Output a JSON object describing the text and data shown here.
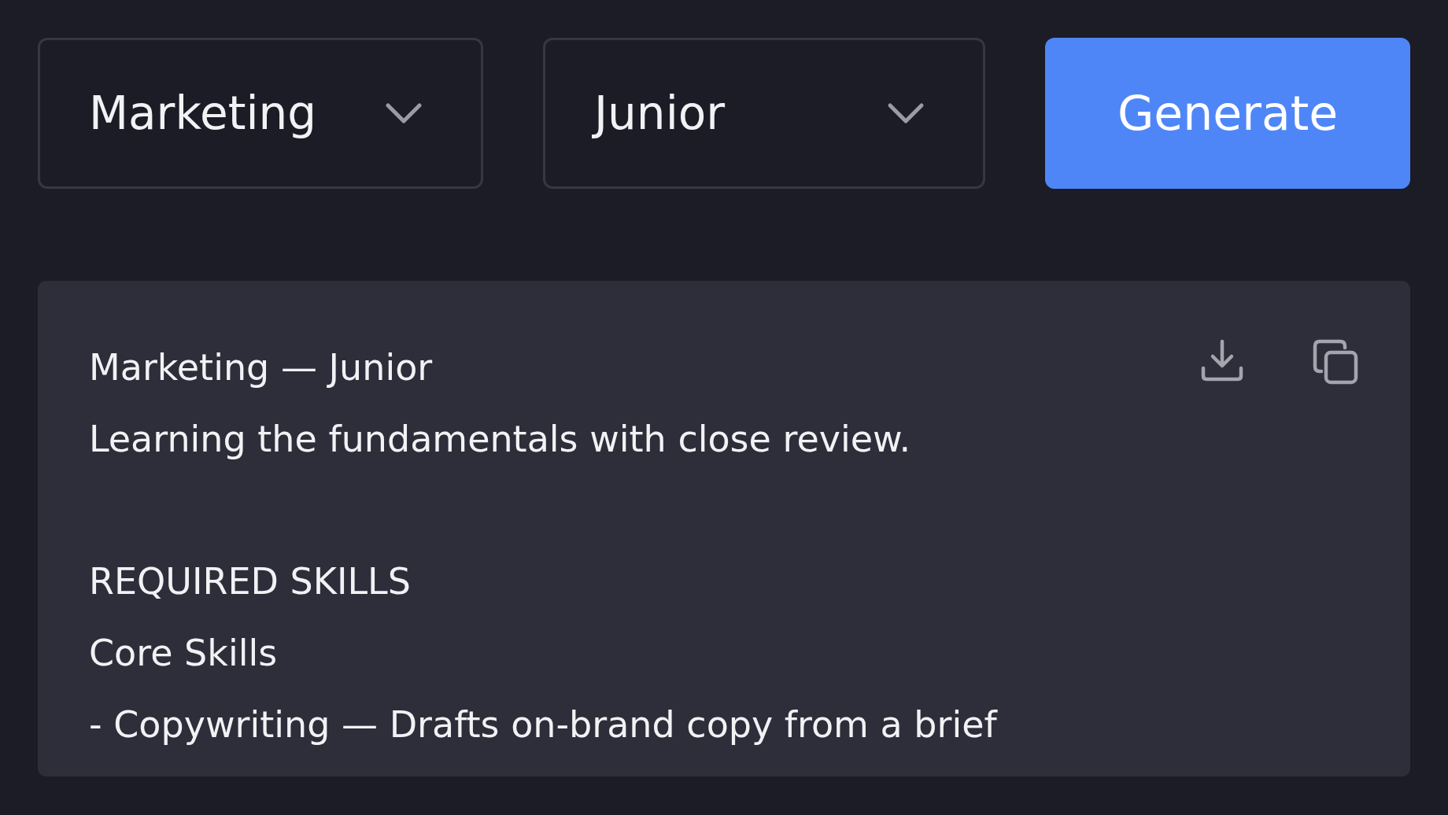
{
  "selects": [
    {
      "value": "Marketing"
    },
    {
      "value": "Junior"
    }
  ],
  "generate_button": {
    "label": "Generate"
  },
  "output": {
    "sections": [
      {
        "lines": [
          "Marketing — Junior",
          "Learning the fundamentals with close review."
        ]
      },
      {
        "lines": [
          "REQUIRED SKILLS",
          "Core Skills",
          "- Copywriting — Drafts on-brand copy from a brief"
        ]
      }
    ]
  }
}
